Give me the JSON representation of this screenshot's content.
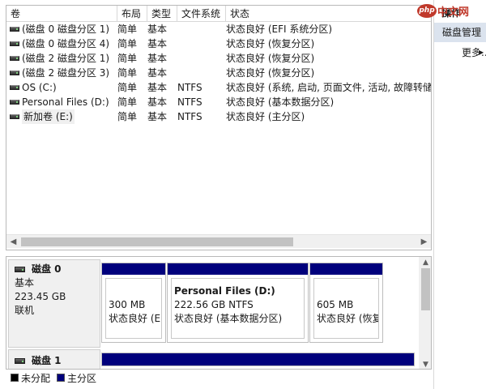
{
  "columns": {
    "volume": "卷",
    "layout": "布局",
    "type": "类型",
    "filesystem": "文件系统",
    "status": "状态"
  },
  "volumes": [
    {
      "name": "(磁盘 0 磁盘分区 1)",
      "layout": "简单",
      "type": "基本",
      "fs": "",
      "status": "状态良好 (EFI 系统分区)"
    },
    {
      "name": "(磁盘 0 磁盘分区 4)",
      "layout": "简单",
      "type": "基本",
      "fs": "",
      "status": "状态良好 (恢复分区)"
    },
    {
      "name": "(磁盘 2 磁盘分区 1)",
      "layout": "简单",
      "type": "基本",
      "fs": "",
      "status": "状态良好 (恢复分区)"
    },
    {
      "name": "(磁盘 2 磁盘分区 3)",
      "layout": "简单",
      "type": "基本",
      "fs": "",
      "status": "状态良好 (恢复分区)"
    },
    {
      "name": "OS (C:)",
      "layout": "简单",
      "type": "基本",
      "fs": "NTFS",
      "status": "状态良好 (系统, 启动, 页面文件, 活动, 故障转储,"
    },
    {
      "name": "Personal Files (D:)",
      "layout": "简单",
      "type": "基本",
      "fs": "NTFS",
      "status": "状态良好 (基本数据分区)"
    },
    {
      "name": "新加卷 (E:)",
      "layout": "简单",
      "type": "基本",
      "fs": "NTFS",
      "status": "状态良好 (主分区)"
    }
  ],
  "disks": [
    {
      "name": "磁盘 0",
      "type": "基本",
      "size": "223.45 GB",
      "state": "联机",
      "partitions": [
        {
          "name": "",
          "size": "300 MB",
          "status": "状态良好 (EI"
        },
        {
          "name": "Personal Files  (D:)",
          "size": "222.56 GB NTFS",
          "status": "状态良好 (基本数据分区)"
        },
        {
          "name": "",
          "size": "605 MB",
          "status": "状态良好 (恢复"
        }
      ]
    },
    {
      "name": "磁盘 1"
    }
  ],
  "legend": [
    {
      "label": "未分配",
      "color": "#000000"
    },
    {
      "label": "主分区",
      "color": "#00007c"
    }
  ],
  "actions": {
    "title": "操作",
    "section": "磁盘管理",
    "more": "更多..."
  },
  "watermark": {
    "badge": "php",
    "text": "中文网"
  },
  "colors": {
    "partition_bar": "#00007c",
    "action_section_bg": "#dbe3ee"
  }
}
